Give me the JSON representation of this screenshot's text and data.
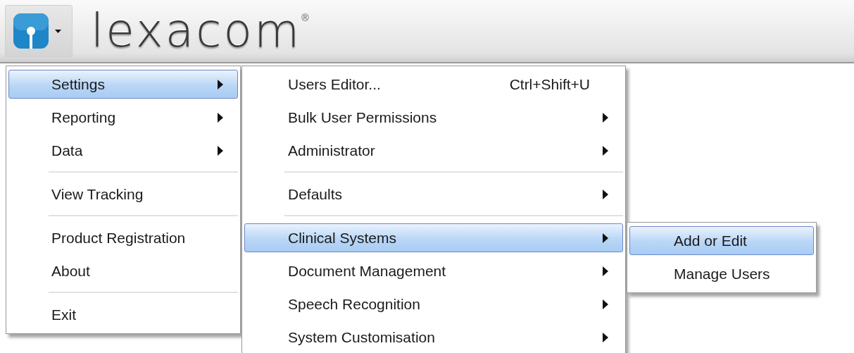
{
  "app_bar": {
    "logo": "lexacom",
    "logo_mark": "®"
  },
  "main_menu": [
    {
      "kind": "item",
      "label": "Settings",
      "selected": true,
      "submenu": true
    },
    {
      "kind": "item",
      "label": "Reporting",
      "selected": false,
      "submenu": true
    },
    {
      "kind": "item",
      "label": "Data",
      "selected": false,
      "submenu": true
    },
    {
      "kind": "separator"
    },
    {
      "kind": "item",
      "label": "View Tracking",
      "selected": false,
      "submenu": false
    },
    {
      "kind": "separator"
    },
    {
      "kind": "item",
      "label": "Product Registration",
      "selected": false,
      "submenu": false
    },
    {
      "kind": "item",
      "label": "About",
      "selected": false,
      "submenu": false
    },
    {
      "kind": "separator"
    },
    {
      "kind": "item",
      "label": "Exit",
      "selected": false,
      "submenu": false
    }
  ],
  "settings_menu": [
    {
      "kind": "item",
      "label": "Users Editor...",
      "shortcut": "Ctrl+Shift+U",
      "selected": false,
      "submenu": false
    },
    {
      "kind": "item",
      "label": "Bulk User Permissions",
      "selected": false,
      "submenu": true
    },
    {
      "kind": "item",
      "label": "Administrator",
      "selected": false,
      "submenu": true
    },
    {
      "kind": "separator"
    },
    {
      "kind": "item",
      "label": "Defaults",
      "selected": false,
      "submenu": true
    },
    {
      "kind": "separator"
    },
    {
      "kind": "item",
      "label": "Clinical Systems",
      "selected": true,
      "submenu": true
    },
    {
      "kind": "item",
      "label": "Document Management",
      "selected": false,
      "submenu": true
    },
    {
      "kind": "item",
      "label": "Speech Recognition",
      "selected": false,
      "submenu": true
    },
    {
      "kind": "item",
      "label": "System Customisation",
      "selected": false,
      "submenu": true
    }
  ],
  "clinical_systems_menu": [
    {
      "kind": "item",
      "label": "Add or Edit",
      "selected": true,
      "submenu": false
    },
    {
      "kind": "item",
      "label": "Manage Users",
      "selected": false,
      "submenu": false
    }
  ]
}
